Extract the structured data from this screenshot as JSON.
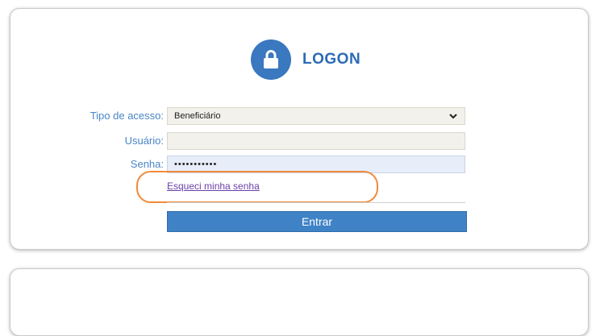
{
  "header": {
    "title": "LOGON",
    "icon": "lock-icon"
  },
  "form": {
    "access_type": {
      "label": "Tipo de acesso:",
      "selected": "Beneficiário"
    },
    "user": {
      "label": "Usuário:",
      "value": ""
    },
    "password": {
      "label": "Senha:",
      "value": "•••••••••••"
    },
    "forgot_link": "Esqueci minha senha",
    "submit_label": "Entrar"
  },
  "colors": {
    "accent": "#3a78c0",
    "label": "#4a86c6",
    "link": "#6b3fa8",
    "highlight": "#f08a3a"
  }
}
